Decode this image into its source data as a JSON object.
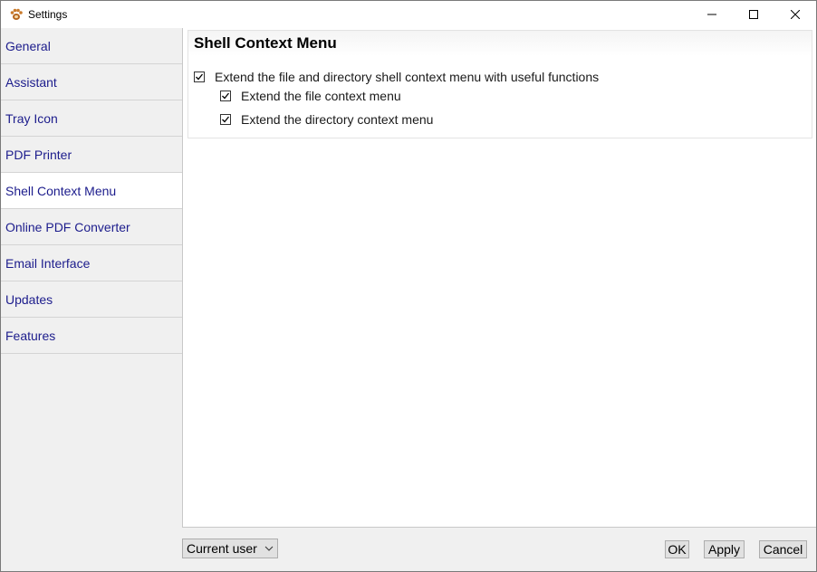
{
  "window": {
    "title": "Settings",
    "app_icon": "paw-app-icon",
    "controls": [
      "minimize-icon",
      "maximize-icon",
      "close-icon"
    ]
  },
  "sidebar": {
    "items": [
      {
        "label": "General"
      },
      {
        "label": "Assistant"
      },
      {
        "label": "Tray Icon"
      },
      {
        "label": "PDF Printer"
      },
      {
        "label": "Shell Context Menu",
        "active": true
      },
      {
        "label": "Online PDF Converter"
      },
      {
        "label": "Email Interface"
      },
      {
        "label": "Updates"
      },
      {
        "label": "Features"
      }
    ]
  },
  "content": {
    "title": "Shell Context Menu",
    "options": [
      {
        "label": "Extend the file and directory shell context menu with useful functions",
        "checked": true
      },
      {
        "label": "Extend the file context menu",
        "checked": true
      },
      {
        "label": "Extend the directory context menu",
        "checked": true
      }
    ]
  },
  "footer": {
    "scope_select": "Current user",
    "ok_label": "OK",
    "apply_label": "Apply",
    "cancel_label": "Cancel"
  },
  "colors": {
    "nav_text": "#1c1c8c",
    "active_bg": "#ffffff",
    "window_bg": "#f0f0f0"
  }
}
